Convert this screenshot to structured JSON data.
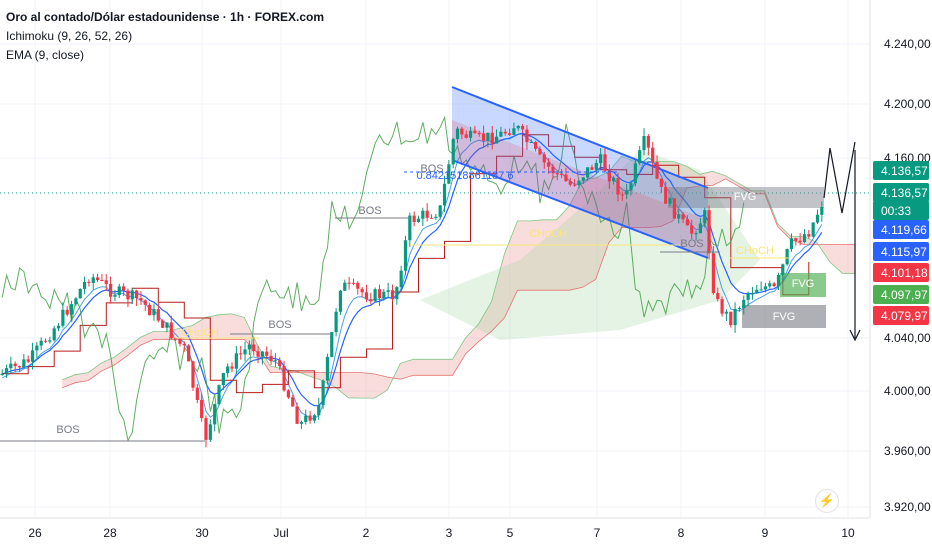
{
  "header": {
    "title": "Oro al contado/Dólar estadounidense · 1h · FOREX.com",
    "indicator_1": "Ichimoku (9, 26, 52, 26)",
    "indicator_2": "EMA (9, close)"
  },
  "chart_data": {
    "type": "candlestick",
    "title": "Oro al contado/Dólar estadounidense · 1h · FOREX.com",
    "y_ticks": [
      "4.240,00",
      "4.200,00",
      "4.160,00",
      "4.040,00",
      "4.000,00",
      "3.960,00",
      "3.920,00"
    ],
    "ylim": [
      3910,
      4255
    ],
    "x_ticks": [
      "26",
      "28",
      "30",
      "Jul",
      "2",
      "3",
      "5",
      "7",
      "8",
      "9",
      "10"
    ],
    "price_tags": [
      {
        "text": "4.136,57",
        "value": 4136.57,
        "color": "#089981"
      },
      {
        "text": "4.136,57",
        "value": 4136.57,
        "color": "#089981"
      },
      {
        "text": "00:33",
        "value": 4128.5,
        "color": "#089981"
      },
      {
        "text": "4.119,66",
        "value": 4119.66,
        "color": "#2962ff"
      },
      {
        "text": "4.115,97",
        "value": 4115.97,
        "color": "#2962ff"
      },
      {
        "text": "4.101,18",
        "value": 4101.18,
        "color": "#f23645"
      },
      {
        "text": "4.097,97",
        "value": 4097.97,
        "color": "#4caf50"
      },
      {
        "text": "4.079,97",
        "value": 4079.97,
        "color": "#f23645"
      }
    ],
    "annotations": [
      {
        "text": "BOS",
        "color": "#787b86"
      },
      {
        "text": "BOS",
        "color": "#787b86"
      },
      {
        "text": "BOS",
        "color": "#787b86"
      },
      {
        "text": "BOS",
        "color": "#787b86"
      },
      {
        "text": "BOS",
        "color": "#787b86"
      },
      {
        "text": "CHoCH",
        "color": "#f7e67a"
      },
      {
        "text": "CHoCH",
        "color": "#f7e67a"
      },
      {
        "text": "CHoCH",
        "color": "#f7e67a"
      },
      {
        "text": "FVG",
        "color": "#ffffff"
      },
      {
        "text": "FVG",
        "color": "#ffffff"
      },
      {
        "text": "FVG",
        "color": "#ffffff"
      },
      {
        "text": "0.8421518861187 6",
        "color": "#2962ff"
      }
    ],
    "colors": {
      "up": "#089981",
      "down": "#f23645",
      "ema": "#2962ff",
      "tenkan": "#2962ff",
      "kijun": "#b71c1c",
      "chikou": "#43a047",
      "cloud_bull": "#a5d6a7",
      "cloud_bear": "#ef9a9a",
      "channel": "#2962ff"
    }
  }
}
